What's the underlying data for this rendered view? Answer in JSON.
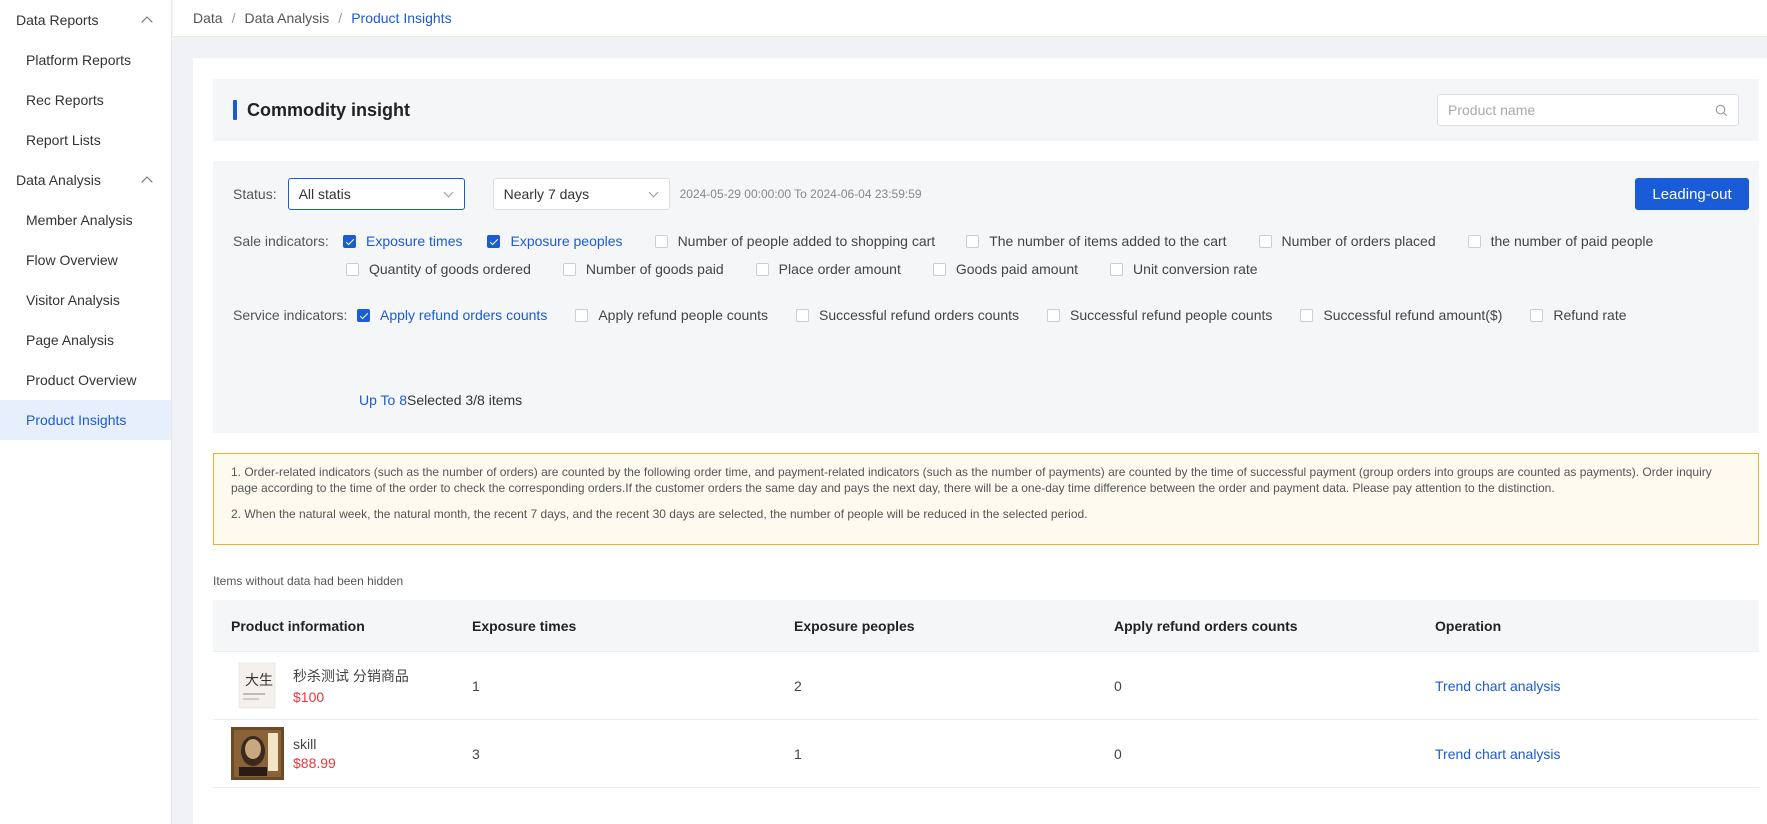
{
  "sidebar": {
    "groups": [
      {
        "label": "Data Reports",
        "items": [
          "Platform Reports",
          "Rec Reports",
          "Report Lists"
        ]
      },
      {
        "label": "Data Analysis",
        "items": [
          "Member Analysis",
          "Flow Overview",
          "Visitor Analysis",
          "Page Analysis",
          "Product Overview",
          "Product Insights"
        ]
      }
    ],
    "active": "Product Insights"
  },
  "breadcrumb": {
    "items": [
      "Data",
      "Data Analysis",
      "Product Insights"
    ],
    "separator": "/"
  },
  "header": {
    "title": "Commodity insight",
    "search_placeholder": "Product name"
  },
  "filters": {
    "status_label": "Status:",
    "status_value": "All statis",
    "period_value": "Nearly 7 days",
    "date_range": "2024-05-29 00:00:00 To 2024-06-04 23:59:59",
    "export_label": "Leading-out",
    "sale_label": "Sale indicators:",
    "sale_indicators": [
      {
        "label": "Exposure times",
        "checked": true
      },
      {
        "label": "Exposure peoples",
        "checked": true
      },
      {
        "label": "Number of people added to shopping cart",
        "checked": false
      },
      {
        "label": "The number of items added to the cart",
        "checked": false
      },
      {
        "label": "Number of orders placed",
        "checked": false
      },
      {
        "label": "the number of paid people",
        "checked": false
      },
      {
        "label": "Quantity of goods ordered",
        "checked": false
      },
      {
        "label": "Number of goods paid",
        "checked": false
      },
      {
        "label": "Place order amount",
        "checked": false
      },
      {
        "label": "Goods paid amount",
        "checked": false
      },
      {
        "label": "Unit conversion rate",
        "checked": false
      }
    ],
    "service_label": "Service indicators:",
    "service_indicators": [
      {
        "label": "Apply refund orders counts",
        "checked": true
      },
      {
        "label": "Apply refund people counts",
        "checked": false
      },
      {
        "label": "Successful refund orders counts",
        "checked": false
      },
      {
        "label": "Successful refund people counts",
        "checked": false
      },
      {
        "label": "Successful refund amount($)",
        "checked": false
      },
      {
        "label": "Refund rate",
        "checked": false
      }
    ],
    "limit_text": "Up To 8",
    "selected_text": "Selected 3/8 items"
  },
  "notice": {
    "line1": "1. Order-related indicators (such as the number of orders) are counted by the following order time, and payment-related indicators (such as the number of payments) are counted by the time of successful payment (group orders into groups are counted as payments). Order inquiry page according to the time of the order to check the corresponding orders.If the customer orders the same day and pays the next day, there will be a one-day time difference between the order and payment data. Please pay attention to the distinction.",
    "line2": "2. When the natural week, the natural month, the recent 7 days, and the recent 30 days are selected, the number of people will be reduced in the selected period."
  },
  "hidden_note": "Items without data had been hidden",
  "table": {
    "columns": [
      "Product information",
      "Exposure times",
      "Exposure peoples",
      "Apply refund orders counts",
      "Operation"
    ],
    "rows": [
      {
        "name": "秒杀测试 分销商品",
        "price": "$100",
        "exposure_times": "1",
        "exposure_peoples": "2",
        "apply_refund_orders": "0",
        "operation": "Trend chart analysis"
      },
      {
        "name": "skill",
        "price": "$88.99",
        "exposure_times": "3",
        "exposure_peoples": "1",
        "apply_refund_orders": "0",
        "operation": "Trend chart analysis"
      }
    ]
  },
  "colors": {
    "accent": "#1a5bd8",
    "price": "#e4393c",
    "notice_border": "#e6b32f"
  }
}
